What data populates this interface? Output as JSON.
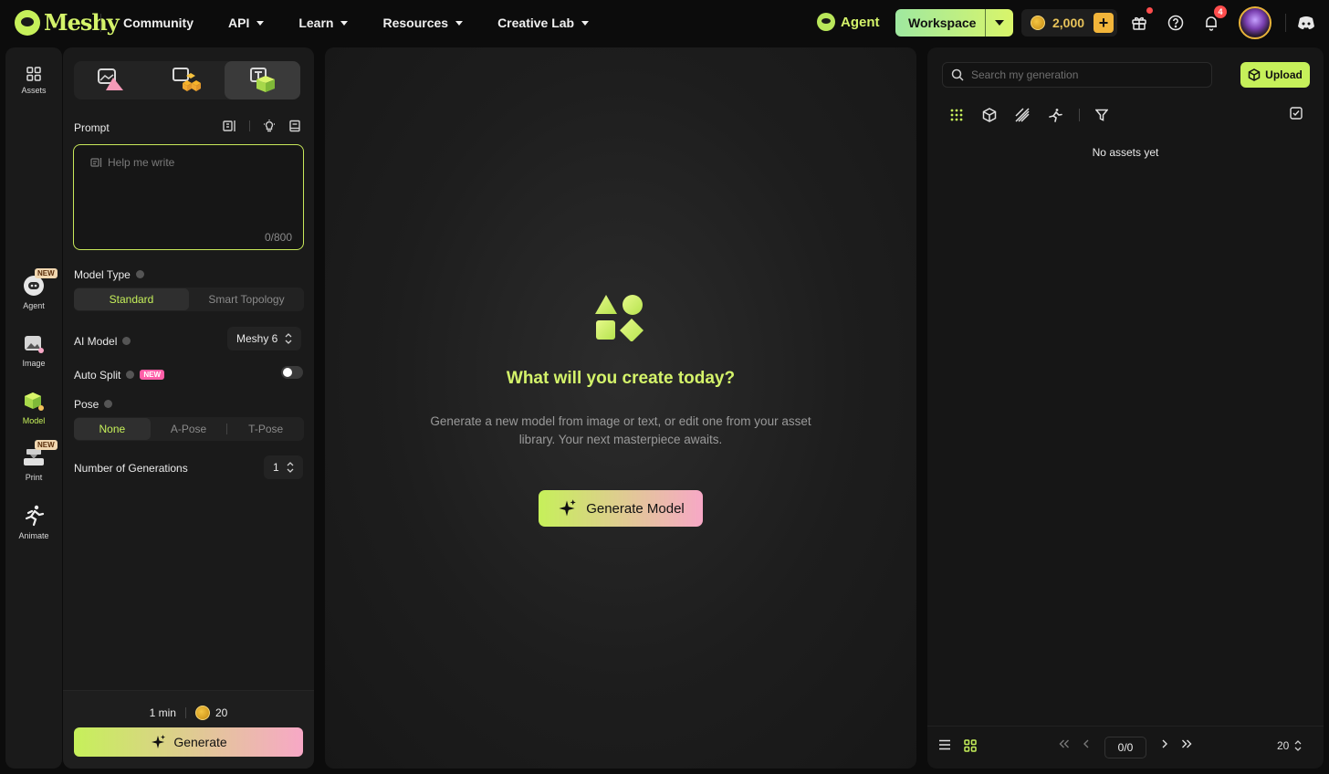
{
  "brand": {
    "name": "Meshy"
  },
  "nav": {
    "items": [
      {
        "label": "Community",
        "has_dropdown": false
      },
      {
        "label": "API",
        "has_dropdown": true
      },
      {
        "label": "Learn",
        "has_dropdown": true
      },
      {
        "label": "Resources",
        "has_dropdown": true
      },
      {
        "label": "Creative Lab",
        "has_dropdown": true
      }
    ]
  },
  "header": {
    "agent_label": "Agent",
    "workspace_label": "Workspace",
    "credits": "2,000",
    "credits_add": "+",
    "notifications_count": "4"
  },
  "rail": {
    "items": [
      {
        "label": "Assets",
        "icon": "grid-icon",
        "new": false,
        "active": false
      },
      {
        "label": "Agent",
        "icon": "agent-icon",
        "new": true,
        "new_label": "NEW",
        "active": false
      },
      {
        "label": "Image",
        "icon": "image-icon",
        "new": false,
        "active": false
      },
      {
        "label": "Model",
        "icon": "cube-icon",
        "new": false,
        "active": true
      },
      {
        "label": "Print",
        "icon": "printer-icon",
        "new": true,
        "new_label": "NEW",
        "active": false
      },
      {
        "label": "Animate",
        "icon": "running-figure-icon",
        "new": false,
        "active": false
      }
    ]
  },
  "panel": {
    "mode_tabs": [
      {
        "icon": "image-to-3d-icon",
        "active": false
      },
      {
        "icon": "multi-image-to-3d-icon",
        "active": false
      },
      {
        "icon": "text-to-3d-icon",
        "active": true
      }
    ],
    "prompt_label": "Prompt",
    "prompt_placeholder": "Help me write",
    "prompt_counter": "0/800",
    "model_type_label": "Model Type",
    "model_type_options": [
      "Standard",
      "Smart Topology"
    ],
    "model_type_selected": "Standard",
    "ai_model_label": "AI Model",
    "ai_model_value": "Meshy 6",
    "auto_split_label": "Auto Split",
    "auto_split_badge": "NEW",
    "auto_split_on": false,
    "pose_label": "Pose",
    "pose_options": [
      "None",
      "A-Pose",
      "T-Pose"
    ],
    "pose_selected": "None",
    "generations_label": "Number of Generations",
    "generations_value": "1",
    "est_time": "1 min",
    "cost": "20",
    "generate_label": "Generate"
  },
  "canvas": {
    "title": "What will you create today?",
    "subtitle": "Generate a new model from image or text, or edit one from your asset library. Your next masterpiece awaits.",
    "cta_label": "Generate Model"
  },
  "assets": {
    "search_placeholder": "Search my generation",
    "upload_label": "Upload",
    "filters": [
      "all-icon",
      "cube-outline-icon",
      "texture-icon",
      "animation-icon"
    ],
    "empty_message": "No assets yet",
    "page_indicator": "0/0",
    "page_size": "20"
  },
  "colors": {
    "accent": "#c6f05a",
    "accent_pink": "#f7a8c6",
    "gold": "#e8c35a",
    "alert": "#ff4d4d"
  }
}
